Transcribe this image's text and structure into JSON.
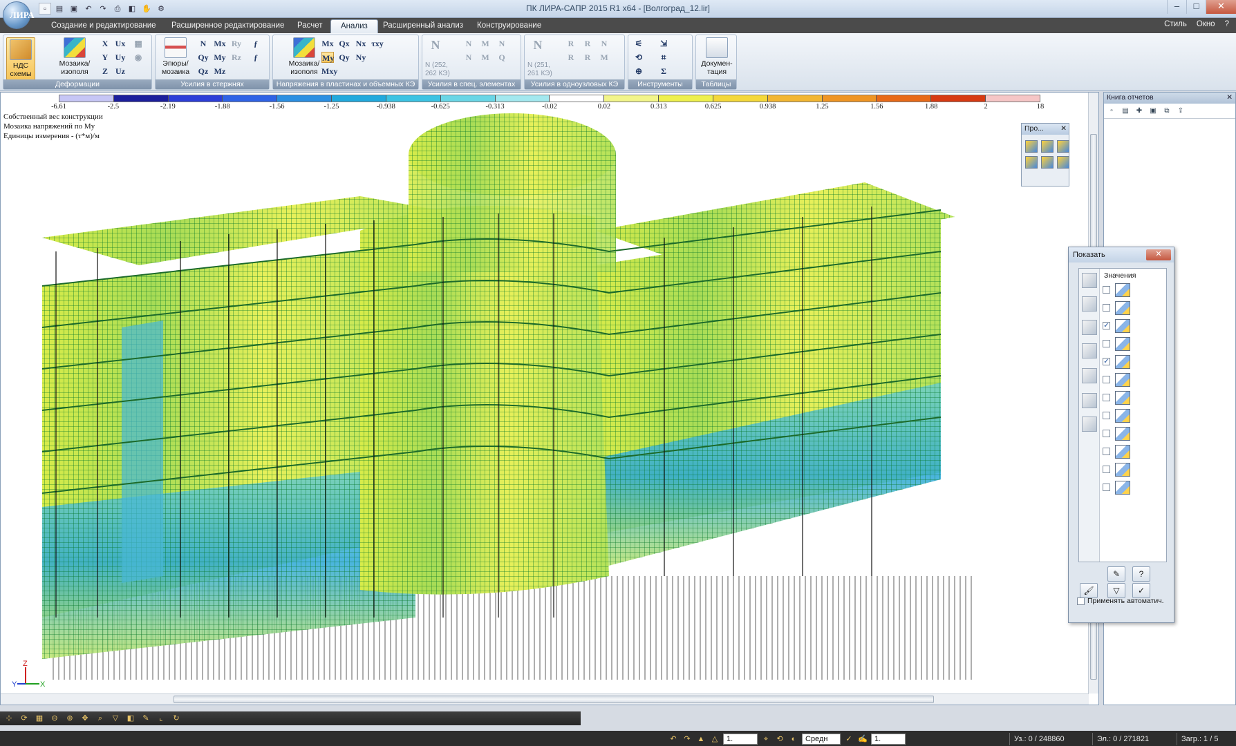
{
  "window": {
    "title": "ПК ЛИРА-САПР  2015 R1 x64 - [Волгоград_12.lir]",
    "app_logo": "ЛИРА",
    "minimize_icon": "minimize-icon",
    "maximize_icon": "maximize-icon",
    "close_icon": "close-icon"
  },
  "qat": [
    "file-icon",
    "open-icon",
    "save-icon",
    "undo-icon",
    "redo-icon",
    "print-icon",
    "model-icon",
    "hand-icon",
    "settings-icon"
  ],
  "tabs": [
    {
      "label": "Создание и редактирование",
      "active": false
    },
    {
      "label": "Расширенное редактирование",
      "active": false
    },
    {
      "label": "Расчет",
      "active": false
    },
    {
      "label": "Анализ",
      "active": true
    },
    {
      "label": "Расширенный анализ",
      "active": false
    },
    {
      "label": "Конструирование",
      "active": false
    }
  ],
  "tabbar_right": {
    "style": "Стиль",
    "window": "Окно"
  },
  "ribbon": {
    "groups": [
      {
        "label": "Деформации"
      },
      {
        "label": "Усилия в стержнях"
      },
      {
        "label": "Напряжения в пластинах и объемных КЭ"
      },
      {
        "label": "Усилия в спец. элементах"
      },
      {
        "label": "Усилия в одноузловых КЭ"
      },
      {
        "label": "Инструменты"
      },
      {
        "label": "Таблицы"
      }
    ],
    "buttons": {
      "nds_schemes": "НДС схемы",
      "mosaic_iso_def": "Мозаика/ изополя",
      "epures_mosaic": "Эпюры/ мозаика",
      "mosaic_iso_stress": "Мозаика/ изополя",
      "documentation": "Докумен- тация"
    },
    "deform_symbols": [
      "X",
      "Ux",
      "Y",
      "Uy",
      "Z",
      "Uz"
    ],
    "rod_symbols": [
      "N",
      "Mx",
      "Ry",
      "Qy",
      "My",
      "Rz",
      "Qz",
      "Mz"
    ],
    "plate_symbols": [
      "Mx",
      "Qx",
      "Nx",
      "τxy",
      "My",
      "Qy",
      "Ny",
      "Mxy"
    ],
    "spec_labels": {
      "n_spec": "N (252, 262 КЭ)",
      "n_single": "N (251, 261 КЭ)"
    }
  },
  "legend": {
    "ticks": [
      "-6.61",
      "-2.5",
      "-2.19",
      "-1.88",
      "-1.56",
      "-1.25",
      "-0.938",
      "-0.625",
      "-0.313",
      "-0.02",
      "0.02",
      "0.313",
      "0.625",
      "0.938",
      "1.25",
      "1.56",
      "1.88",
      "2",
      "18"
    ],
    "colors": [
      "#c6c6f5",
      "#1c1f9c",
      "#2d3ed8",
      "#2f63e6",
      "#2b8fe2",
      "#21a9dd",
      "#3cc3e3",
      "#6ad6e6",
      "#a3e8ef",
      "#ffffff",
      "#f2f58a",
      "#eef04c",
      "#f4d83a",
      "#f2b632",
      "#ef9524",
      "#e86a18",
      "#d73a12",
      "#f6c6c6"
    ]
  },
  "info_lines": [
    "Собственный вес конструкции",
    "Мозаика напряжений по My",
    "Единицы измерения - (т*м)/м"
  ],
  "axes": {
    "x": "X",
    "y": "Y",
    "z": "Z"
  },
  "proj_panel": {
    "title": "Про...",
    "icons": [
      "view-front-icon",
      "view-back-icon",
      "view-side-icon",
      "view-top-icon",
      "view-bottom-icon",
      "view-iso-icon"
    ]
  },
  "reports_panel": {
    "title": "Книга отчетов"
  },
  "show_dialog": {
    "title": "Показать",
    "column_header": "Значения",
    "rows": [
      {
        "icon": "values-numbers-icon",
        "checked": false
      },
      {
        "icon": "values-colored-icon",
        "checked": false
      },
      {
        "icon": "mosaic-icon",
        "checked": true
      },
      {
        "icon": "isofield-icon",
        "checked": false
      },
      {
        "icon": "mesh-icon",
        "checked": true
      },
      {
        "icon": "scale-factor-icon",
        "checked": false
      },
      {
        "icon": "precision-icon",
        "checked": false
      },
      {
        "icon": "max-value-icon",
        "checked": false
      },
      {
        "icon": "hatch-icon",
        "checked": false
      },
      {
        "icon": "reinforcement-asw-icon",
        "checked": false
      },
      {
        "icon": "reinforcement-ka-icon",
        "checked": false
      },
      {
        "icon": "link-icon",
        "checked": false
      }
    ],
    "auto_apply": "Применять автоматич."
  },
  "status": {
    "scale_value": "1.",
    "view_mode": "Средн",
    "step_value": "1.",
    "nodes": "Уз.: 0 / 248860",
    "elements": "Эл.: 0 / 271821",
    "load_case": "Загр.: 1 / 5"
  }
}
